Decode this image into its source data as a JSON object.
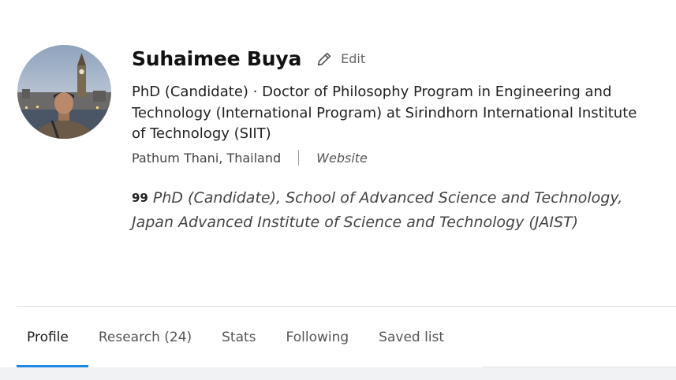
{
  "profile": {
    "name": "Suhaimee Buya",
    "edit_label": "Edit",
    "headline": "PhD (Candidate) · Doctor of Philosophy Program in Engineering and Technology (International Program) at Sirindhorn International Institute of Technology (SIIT)",
    "location": "Pathum Thani, Thailand",
    "website_label": "Website",
    "quote_mark": "99",
    "quote": "PhD (Candidate), School of Advanced Science and Technology, Japan Advanced Institute of Science and Technology (JAIST)",
    "avatar_icon": "user-photo"
  },
  "tabs": [
    {
      "label": "Profile",
      "active": true
    },
    {
      "label": "Research (24)",
      "active": false
    },
    {
      "label": "Stats",
      "active": false
    },
    {
      "label": "Following",
      "active": false
    },
    {
      "label": "Saved list",
      "active": false
    }
  ],
  "colors": {
    "accent": "#1e88e5",
    "text": "#1a1a1a",
    "muted": "#555555"
  }
}
